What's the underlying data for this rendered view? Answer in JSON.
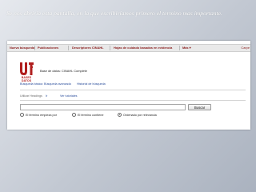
{
  "caption": "Se nos abriría esta pantalla, en la que escribiríamos  primero el termino mas importante.",
  "nav": {
    "items": [
      "Nueva búsqueda",
      "Publicaciones",
      "Descriptores CINAHL",
      "Hojas de cuidado basadas en evidencia",
      "Más ▾"
    ],
    "right": "Carpe"
  },
  "logo": {
    "line1": "BASES",
    "line2": "DATOS"
  },
  "database_label": "Base de datos: CINAHL Complete",
  "tabs": [
    "Búsqueda básica",
    "Búsqueda avanzada",
    "Historial de búsqueda"
  ],
  "subtabs": [
    "Utilizar Headings",
    "Ir",
    "Ver tutoriales"
  ],
  "search": {
    "value": "",
    "button_label": "Buscar"
  },
  "radios": {
    "options": [
      "El término empieza por",
      "El término contiene",
      "Ordenado por relevancia"
    ],
    "selected_index": 2
  },
  "colors": {
    "nav_text": "#8a1c1c",
    "link": "#2a4d9b",
    "logo": "#b01e1e"
  }
}
